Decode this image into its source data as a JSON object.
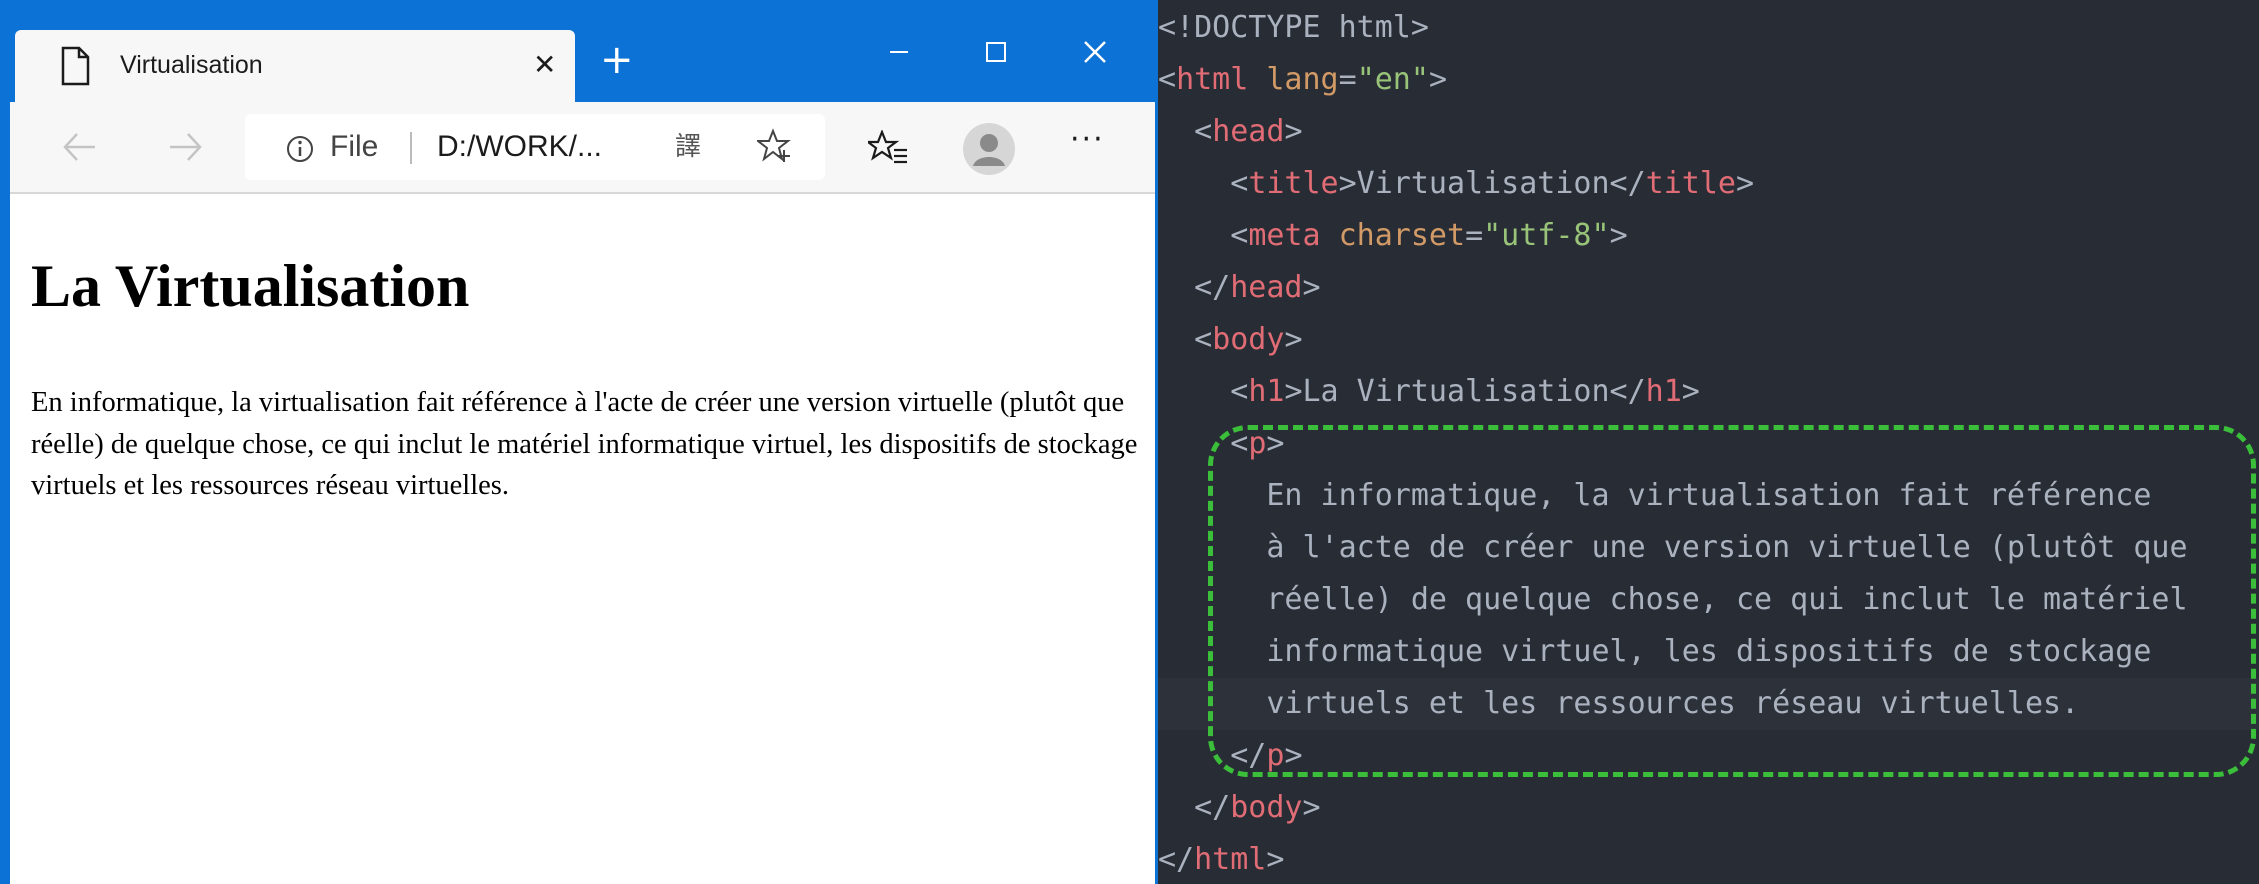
{
  "browser": {
    "tab": {
      "title": "Virtualisation",
      "close": "✕",
      "icon": "page-icon"
    },
    "new_tab": "+",
    "window_controls": {
      "minimize": "minimize-icon",
      "maximize": "maximize-icon",
      "close": "close-icon"
    },
    "toolbar": {
      "back_icon": "back-arrow-icon",
      "forward_icon": "forward-arrow-icon",
      "address": {
        "scheme_label": "File",
        "url": "D:/WORK/...",
        "info_icon": "info-icon",
        "translate_icon": "translate-icon",
        "favorite_add_icon": "star-add-icon"
      },
      "favorites_icon": "favorites-icon",
      "profile_icon": "profile-avatar-icon",
      "menu": "···"
    },
    "page": {
      "heading": "La Virtualisation",
      "paragraph": "En informatique, la virtualisation fait référence à l'acte de créer une version virtuelle (plutôt que réelle) de quelque chose, ce qui inclut le matériel informatique virtuel, les dispositifs de stockage virtuels et les ressources réseau virtuelles."
    }
  },
  "editor": {
    "colors": {
      "background": "#282c34",
      "tag": "#e06c75",
      "attribute": "#d19a66",
      "string": "#98c379",
      "text": "#abb2bf",
      "highlight_border": "#3bbf3b"
    },
    "lines": [
      [
        {
          "t": "<!DOCTYPE html>",
          "c": "punc"
        }
      ],
      [
        {
          "t": "<",
          "c": "punc"
        },
        {
          "t": "html",
          "c": "tag"
        },
        {
          "t": " ",
          "c": "punc"
        },
        {
          "t": "lang",
          "c": "attr"
        },
        {
          "t": "=",
          "c": "punc"
        },
        {
          "t": "\"en\"",
          "c": "str"
        },
        {
          "t": ">",
          "c": "punc"
        }
      ],
      [
        {
          "t": "  <",
          "c": "punc"
        },
        {
          "t": "head",
          "c": "tag"
        },
        {
          "t": ">",
          "c": "punc"
        }
      ],
      [
        {
          "t": "    <",
          "c": "punc"
        },
        {
          "t": "title",
          "c": "tag"
        },
        {
          "t": ">Virtualisation</",
          "c": "punc"
        },
        {
          "t": "title",
          "c": "tag"
        },
        {
          "t": ">",
          "c": "punc"
        }
      ],
      [
        {
          "t": "    <",
          "c": "punc"
        },
        {
          "t": "meta",
          "c": "tag"
        },
        {
          "t": " ",
          "c": "punc"
        },
        {
          "t": "charset",
          "c": "attr"
        },
        {
          "t": "=",
          "c": "punc"
        },
        {
          "t": "\"utf-8\"",
          "c": "str"
        },
        {
          "t": ">",
          "c": "punc"
        }
      ],
      [
        {
          "t": "  </",
          "c": "punc"
        },
        {
          "t": "head",
          "c": "tag"
        },
        {
          "t": ">",
          "c": "punc"
        }
      ],
      [
        {
          "t": "  <",
          "c": "punc"
        },
        {
          "t": "body",
          "c": "tag"
        },
        {
          "t": ">",
          "c": "punc"
        }
      ],
      [
        {
          "t": "    <",
          "c": "punc"
        },
        {
          "t": "h1",
          "c": "tag"
        },
        {
          "t": ">La Virtualisation</",
          "c": "punc"
        },
        {
          "t": "h1",
          "c": "tag"
        },
        {
          "t": ">",
          "c": "punc"
        }
      ],
      [
        {
          "t": "    <",
          "c": "punc"
        },
        {
          "t": "p",
          "c": "tag"
        },
        {
          "t": ">",
          "c": "punc"
        }
      ],
      [
        {
          "t": "      En informatique, la virtualisation fait référence",
          "c": "punc"
        }
      ],
      [
        {
          "t": "      à l'acte de créer une version virtuelle (plutôt que",
          "c": "punc"
        }
      ],
      [
        {
          "t": "      réelle) de quelque chose, ce qui inclut le matériel",
          "c": "punc"
        }
      ],
      [
        {
          "t": "      informatique virtuel, les dispositifs de stockage",
          "c": "punc"
        }
      ],
      [
        {
          "t": "      virtuels et les ressources réseau virtuelles.",
          "c": "punc",
          "hl": true
        }
      ],
      [
        {
          "t": "    </",
          "c": "punc"
        },
        {
          "t": "p",
          "c": "tag"
        },
        {
          "t": ">",
          "c": "punc"
        }
      ],
      [
        {
          "t": "  </",
          "c": "punc"
        },
        {
          "t": "body",
          "c": "tag"
        },
        {
          "t": ">",
          "c": "punc"
        }
      ],
      [
        {
          "t": "</",
          "c": "punc"
        },
        {
          "t": "html",
          "c": "tag"
        },
        {
          "t": ">",
          "c": "punc"
        }
      ]
    ]
  }
}
